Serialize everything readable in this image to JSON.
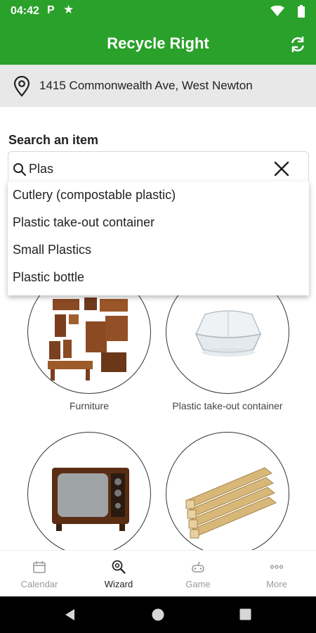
{
  "status_bar": {
    "time": "04:42",
    "notification_p": "P"
  },
  "app_bar": {
    "title": "Recycle Right"
  },
  "address": {
    "text": "1415 Commonwealth Ave, West Newton"
  },
  "search": {
    "label": "Search an item",
    "value": "Plas"
  },
  "suggestions": [
    "Cutlery (compostable plastic)",
    "Plastic take-out container",
    "Small Plastics",
    "Plastic bottle"
  ],
  "items": [
    {
      "label": "Furniture"
    },
    {
      "label": "Plastic take-out container"
    }
  ],
  "bottom_nav": [
    {
      "label": "Calendar"
    },
    {
      "label": "Wizard"
    },
    {
      "label": "Game"
    },
    {
      "label": "More"
    }
  ],
  "colors": {
    "primary": "#2aa12a",
    "address_bg": "#e8e8e8"
  }
}
